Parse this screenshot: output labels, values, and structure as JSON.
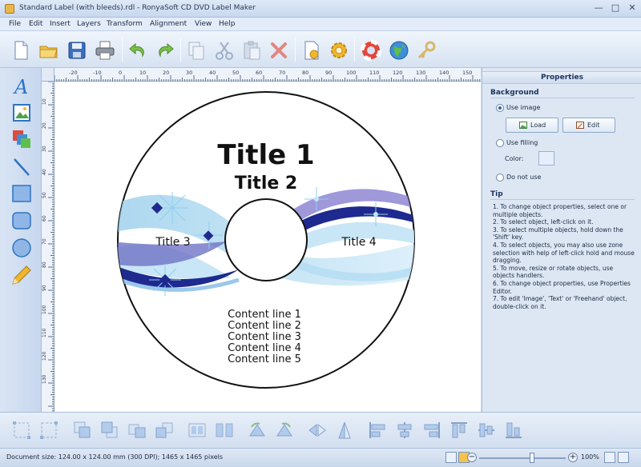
{
  "window": {
    "title": "Standard Label (with bleeds).rdl - RonyaSoft CD DVD Label Maker",
    "min_glyph": "—",
    "max_glyph": "□",
    "close_glyph": "✕"
  },
  "menu": [
    "File",
    "Edit",
    "Insert",
    "Layers",
    "Transform",
    "Alignment",
    "View",
    "Help"
  ],
  "toolbar_icons": [
    "new-document-icon",
    "open-folder-icon",
    "save-icon",
    "print-icon",
    "undo-icon",
    "redo-icon",
    "copy-icon",
    "cut-icon",
    "paste-icon",
    "delete-icon",
    "document-properties-icon",
    "settings-gear-icon",
    "help-lifebuoy-icon",
    "web-globe-icon",
    "key-icon"
  ],
  "tools": [
    "text-tool-icon",
    "image-tool-icon",
    "clipart-tool-icon",
    "line-tool-icon",
    "rectangle-tool-icon",
    "rounded-rectangle-tool-icon",
    "ellipse-tool-icon",
    "pencil-tool-icon"
  ],
  "ruler_h": [
    "-20",
    "-10",
    "0",
    "10",
    "20",
    "30",
    "40",
    "50",
    "60",
    "70",
    "80",
    "90",
    "100",
    "110",
    "120",
    "130",
    "140",
    "150"
  ],
  "ruler_v": [
    "10",
    "20",
    "30",
    "40",
    "50",
    "60",
    "70",
    "80",
    "90",
    "100",
    "110",
    "120",
    "130"
  ],
  "label": {
    "title1": "Title 1",
    "title2": "Title 2",
    "title3": "Title 3",
    "title4": "Title 4",
    "content_lines": [
      "Content line 1",
      "Content line 2",
      "Content line 3",
      "Content line 4",
      "Content line 5"
    ]
  },
  "properties": {
    "header": "Properties",
    "background_title": "Background",
    "use_image": "Use image",
    "load_button": "Load",
    "edit_button": "Edit",
    "use_filling": "Use filling",
    "color_label": "Color:",
    "do_not_use": "Do not use",
    "tip_title": "Tip",
    "tip_text": "1. To change object properties, select one or multiple objects.\n2. To select object, left-click on it.\n3. To select multiple objects, hold down the 'Shift' key.\n4. To select objects, you may also use zone selection with help of left-click hold and mouse dragging.\n5. To move, resize or rotate objects, use objects handlers.\n6. To change object properties, use Properties Editor.\n7. To edit 'Image', 'Text' or 'Freehand' object, double-click on it."
  },
  "bottom_icons": [
    "fit-page-icon",
    "fit-selection-icon",
    "bring-front-icon",
    "send-back-icon",
    "bring-forward-icon",
    "send-backward-icon",
    "group-icon",
    "ungroup-icon",
    "rotate-left-icon",
    "rotate-right-icon",
    "flip-horizontal-icon",
    "flip-vertical-icon",
    "align-left-icon",
    "align-center-icon",
    "align-right-icon",
    "align-top-icon",
    "align-middle-icon",
    "align-bottom-icon"
  ],
  "status": {
    "doc_size": "Document size: 124.00 x 124.00 mm (300 DPI); 1465 x 1465 pixels",
    "zoom": "100%",
    "zoom_level": 0.6
  }
}
